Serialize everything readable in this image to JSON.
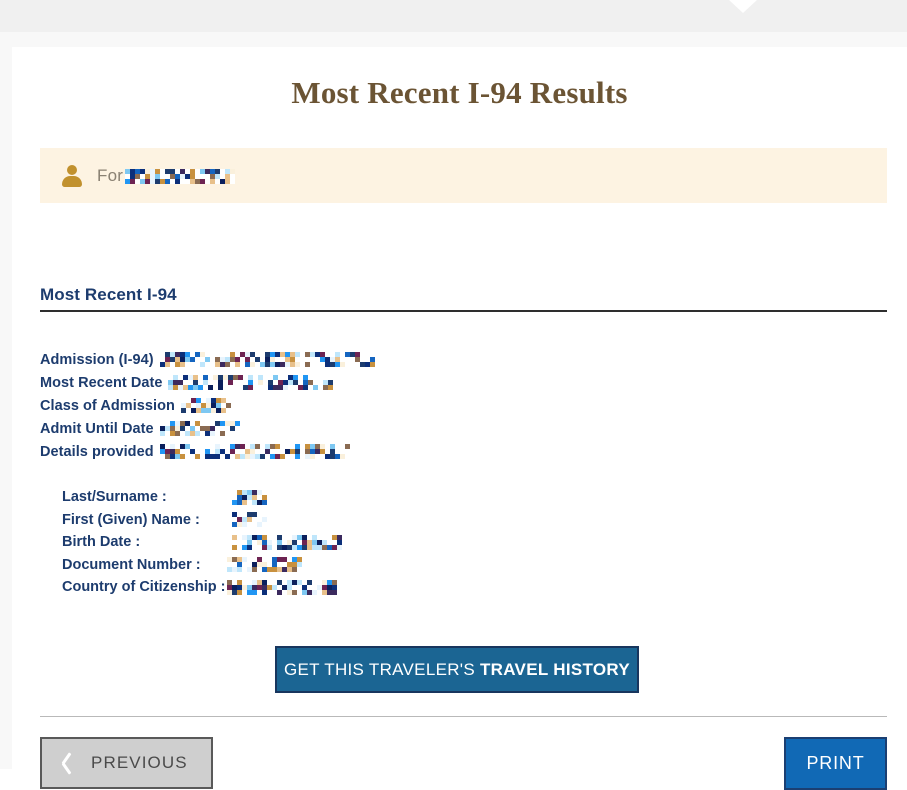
{
  "window": {
    "top_band_color": "#f0f0f0",
    "sub_band_color": "#f8f8f8",
    "notch_color": "#ffffff"
  },
  "page": {
    "title": "Most Recent I-94 Results",
    "title_color": "#6b5434"
  },
  "notice": {
    "icon": "person-icon",
    "icon_color": "#c1912e",
    "background_color": "#fdf3e2",
    "text": "For",
    "text_color": "#8a8173",
    "redaction": {
      "redacted": true,
      "width": 110,
      "height": 13
    }
  },
  "section": {
    "heading": "Most Recent I-94",
    "heading_color": "#1d3c6e",
    "rule_color": "#2e2e2e"
  },
  "fields": [
    {
      "label": "Admission (I-94)",
      "value_redacted": true,
      "redaction_width": 214,
      "redaction_height": 15
    },
    {
      "label": "Most Recent Date",
      "value_redacted": true,
      "redaction_width": 164,
      "redaction_height": 15
    },
    {
      "label": "Class of Admission",
      "value_redacted": true,
      "redaction_width": 51,
      "redaction_height": 15
    },
    {
      "label": "Admit Until Date",
      "value_redacted": true,
      "redaction_width": 78,
      "redaction_height": 13
    },
    {
      "label": "Details provided",
      "value_redacted": true,
      "redaction_width": 192,
      "redaction_height": 15
    }
  ],
  "traveler_details": [
    {
      "label": "Last/Surname :",
      "value_redacted": true,
      "redaction_width": 42,
      "redaction_height": 13
    },
    {
      "label": "First (Given) Name :",
      "value_redacted": true,
      "redaction_width": 40,
      "redaction_height": 13
    },
    {
      "label": "Birth Date :",
      "value_redacted": true,
      "redaction_width": 113,
      "redaction_height": 13
    },
    {
      "label": "Document Number :",
      "value_redacted": true,
      "redaction_width": 76,
      "redaction_height": 13
    },
    {
      "label": "Country of Citizenship :",
      "value_redacted": true,
      "redaction_width": 110,
      "redaction_height": 15
    }
  ],
  "actions": {
    "travel_history_prefix": "GET THIS TRAVELER'S",
    "travel_history_strong": "TRAVEL HISTORY",
    "travel_history_bg": "#1b6593",
    "travel_history_border": "#18365e",
    "previous_label": "PREVIOUS",
    "previous_icon": "chevron-left-icon",
    "previous_bg": "#cfcfcf",
    "print_label": "PRINT",
    "print_bg": "#1169b5"
  },
  "redaction_palette": [
    "#0b1f5c",
    "#0c2f7a",
    "#1565c0",
    "#2196f3",
    "#7ec8f2",
    "#bfe6fb",
    "#e8f4fd",
    "#faf0dc",
    "#e8c08a",
    "#c8913f",
    "#8a6b52",
    "#6d2352",
    "#3b2a5e",
    "#ffffff",
    "#1d3c6e"
  ]
}
